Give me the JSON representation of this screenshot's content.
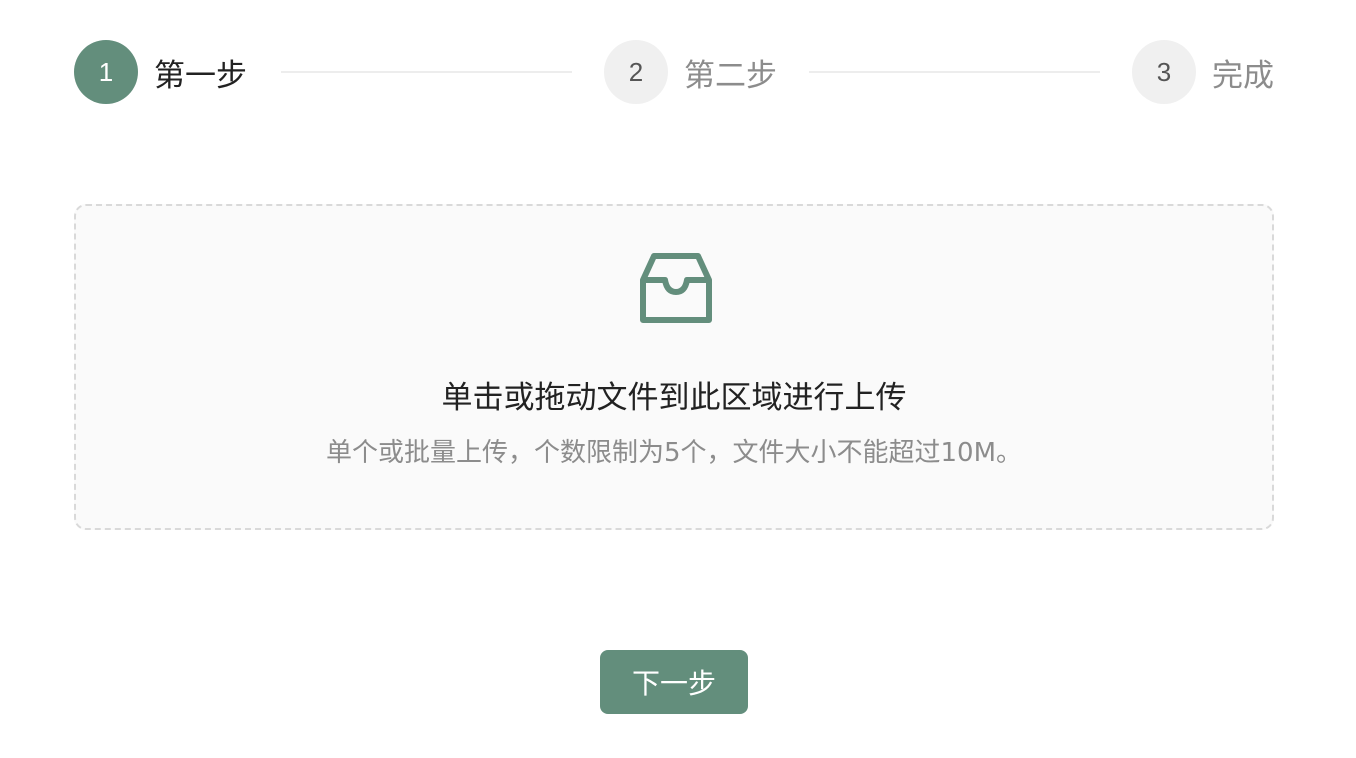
{
  "theme": {
    "accent": "#638e7c",
    "pending_circle_bg": "#f0f0f0",
    "text_primary": "#222222",
    "text_secondary": "#8c8c8c",
    "dropzone_bg": "#fafafa",
    "dropzone_border": "#d9d9d9"
  },
  "steps": [
    {
      "number": "1",
      "title": "第一步",
      "status": "active"
    },
    {
      "number": "2",
      "title": "第二步",
      "status": "pending"
    },
    {
      "number": "3",
      "title": "完成",
      "status": "pending"
    }
  ],
  "upload": {
    "icon": "inbox-icon",
    "title": "单击或拖动文件到此区域进行上传",
    "hint": "单个或批量上传，个数限制为5个，文件大小不能超过10M。"
  },
  "actions": {
    "next_label": "下一步"
  }
}
